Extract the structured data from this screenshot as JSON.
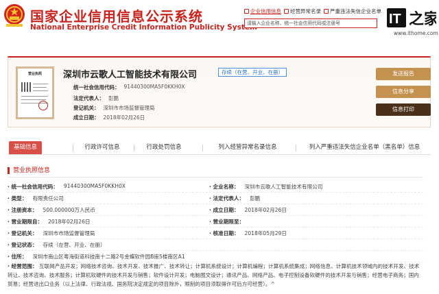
{
  "header": {
    "title_cn": "国家企业信用信息公示系统",
    "title_en": "National Enterprise Credit Information Publicity System",
    "nav": [
      {
        "label": "企业信用信息",
        "active": true
      },
      {
        "label": "经营异常名录",
        "active": false
      },
      {
        "label": "严重违法失信企业名单",
        "active": false
      }
    ],
    "search_placeholder": "请输入企业名称、统一社会信用代码或注册号",
    "watermark_logo": "IT之家",
    "watermark_domain": "www.ithome.com"
  },
  "license_thumb": {
    "title": "营业执照"
  },
  "company": {
    "name": "深圳市云歌人工智能技术有限公司",
    "status": "存续（在营、开业、在册）",
    "fields": [
      {
        "label": "统一社会信用代码：",
        "value": "91440300MA5F0KKH0X"
      },
      {
        "label": "法定代表人：",
        "value": "彭鹏"
      },
      {
        "label": "登记机关：",
        "value": "深圳市市场监督管理局"
      },
      {
        "label": "成立日期：",
        "value": "2018年02月26日"
      }
    ],
    "buttons": {
      "report": "发送报告",
      "share": "信息分享",
      "print": "信息打印"
    }
  },
  "tabs": [
    {
      "label": "基础信息",
      "active": true
    },
    {
      "label": "行政许可信息",
      "active": false
    },
    {
      "label": "行政处罚信息",
      "active": false
    },
    {
      "label": "列入经营异常名录信息",
      "active": false
    },
    {
      "label": "列入严重违法失信企业名单（黑名单）信息",
      "active": false
    }
  ],
  "license_info": {
    "title": "营业执照信息",
    "rows": [
      [
        {
          "label": "· 统一社会信用代码：",
          "value": "91440300MA5F0KKH0X"
        },
        {
          "label": "· 企业名称：",
          "value": "深圳市云歌人工智能技术有限公司"
        }
      ],
      [
        {
          "label": "· 类型：",
          "value": "有限责任公司"
        },
        {
          "label": "· 法定代表人：",
          "value": "彭鹏"
        }
      ],
      [
        {
          "label": "· 注册资本：",
          "value": "500.000000万人民币"
        },
        {
          "label": "· 成立日期：",
          "value": "2018年02月26日"
        }
      ],
      [
        {
          "label": "· 营业期限自：",
          "value": "2018年02月26日"
        },
        {
          "label": "· 营业期限至：",
          "value": ""
        }
      ],
      [
        {
          "label": "· 登记机关：",
          "value": "深圳市市场监督管理局"
        },
        {
          "label": "· 核准日期：",
          "value": "2018年05月29日"
        }
      ],
      [
        {
          "label": "· 登记状态：",
          "value": "存续（在营、开业、在册）"
        },
        {
          "label": "",
          "value": ""
        }
      ],
      [
        {
          "label": "· 住所：",
          "value": "深圳市南山区粤海街道科技南十二路2号金蝶软件园B座5楼南区A1"
        },
        {
          "label": "",
          "value": ""
        }
      ]
    ],
    "scope_label": "· 经营范围：",
    "scope_value": "互联网产品开发；网络技术咨询、技术开发、技术推广、技术转让；计算机系统设计；计算机编程；计算机系统集成；网络信息、计算机技术领域内的技术开发、技术转让、技术咨询、技术服务；计算机软硬件的技术开发与销售；软件设计开发；电脑图文设计；通讯产品、网络产品、电子控制设备软硬件的技术开发与销售；经营电子商务；国内贸易；经营进出口业务（以上法律、行政法规、国务院决定规定的项目除外，限制的项目须取得许可后方可经营）。^"
  },
  "colors": {
    "brand_red": "#c8231c",
    "button_gold": "#c4924e",
    "button_dark": "#4a2f1a",
    "tab_active": "#d85048",
    "status_blue": "#2a6fbd"
  }
}
